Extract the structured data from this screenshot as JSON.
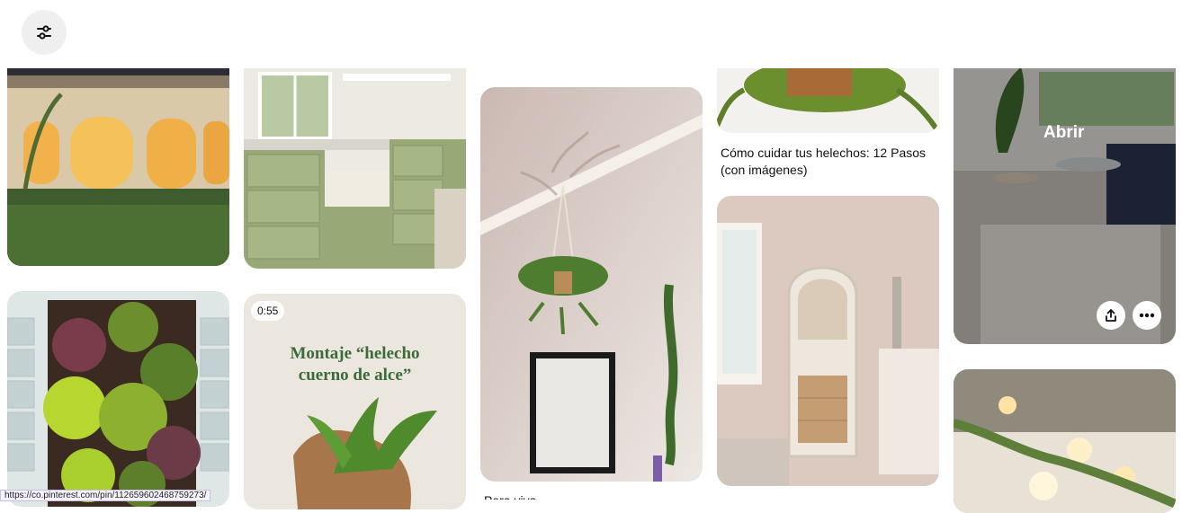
{
  "toolbar": {
    "filter_icon": "sliders-icon"
  },
  "pins": {
    "p_kitchen_label": "",
    "fern_caption": "Cómo cuidar tus helechos: 12 Pasos (con imágenes)",
    "video_duration": "0:55",
    "video_title_line1": "Montaje “helecho",
    "video_title_line2": "cuerno de alce”",
    "tall_fern_caption": "Pera viva",
    "hover_open_label": "Abrir",
    "share_icon": "share-icon",
    "more_icon": "more-icon"
  },
  "status_bar": {
    "url": "https://co.pinterest.com/pin/112659602468759273/"
  },
  "colors": {
    "background": "#ffffff",
    "button_bg": "#efefef",
    "fern_green": "#3c6b3a"
  }
}
